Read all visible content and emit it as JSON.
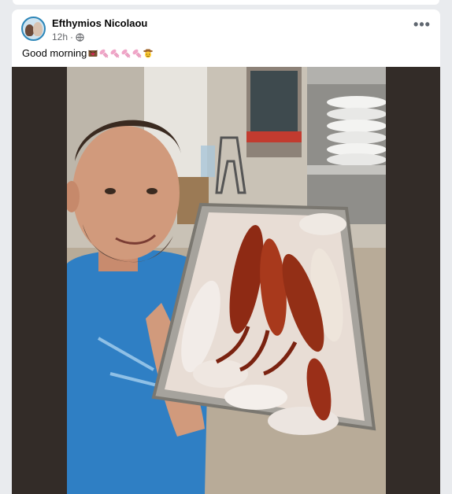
{
  "post": {
    "author": "Efthymios Nicolaou",
    "time": "12h",
    "separator": "·",
    "caption_text": "Good morning",
    "caption_emojis": [
      "love-letter-emoji",
      "squid-emoji",
      "squid-emoji",
      "squid-emoji",
      "squid-emoji",
      "cowboy-face-emoji"
    ],
    "more_label": "•••"
  },
  "photo": {
    "description_icon": "photo-image"
  },
  "colors": {
    "card": "#ffffff",
    "page": "#e9ebee",
    "photo_frame": "#332c28",
    "muted_text": "#65676b"
  }
}
